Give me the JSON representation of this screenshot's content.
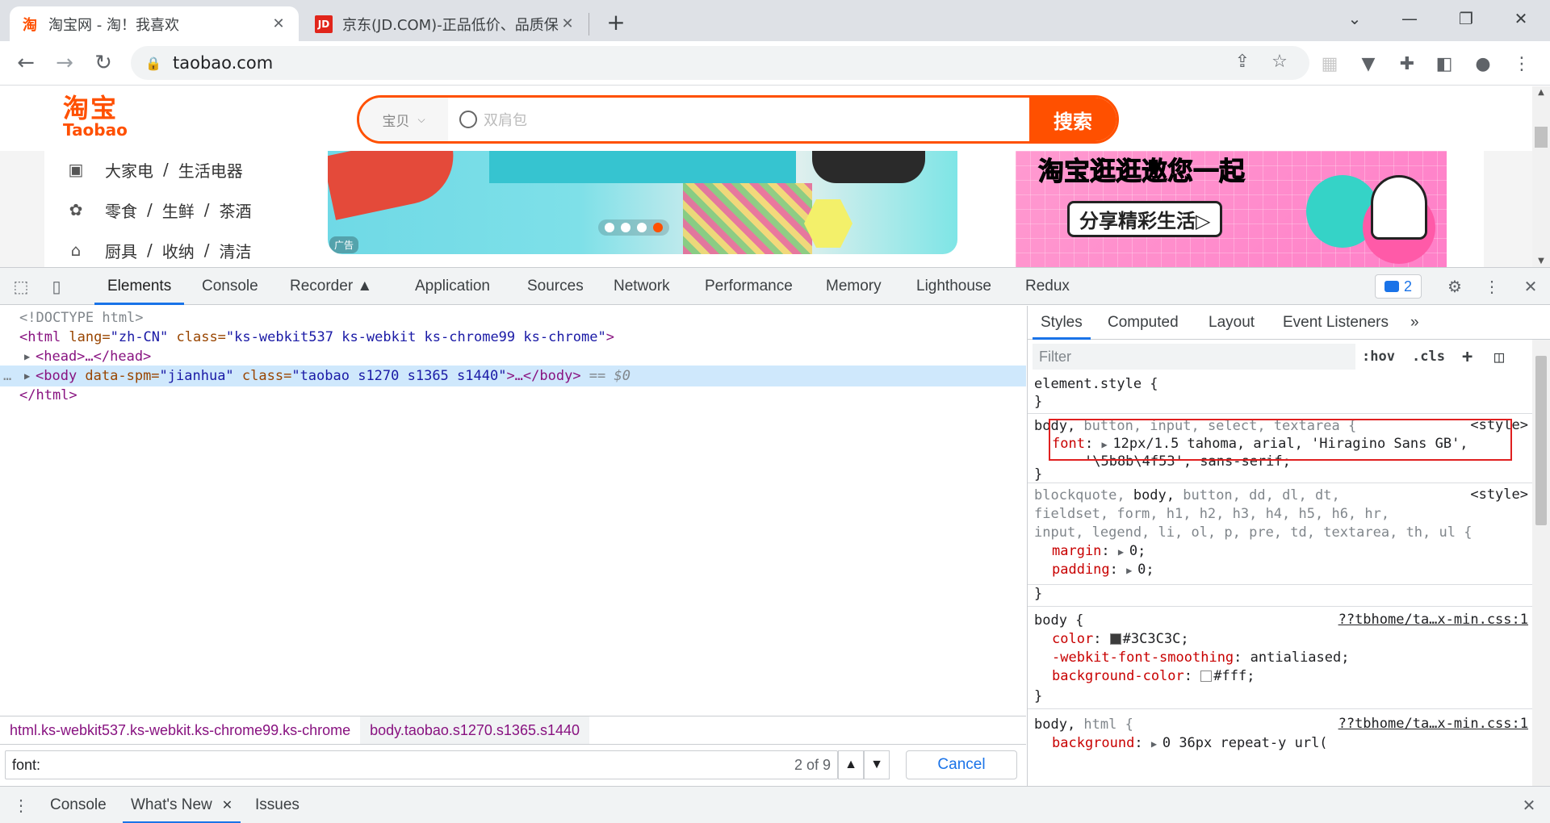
{
  "browser": {
    "tabs": [
      {
        "favicon": "淘",
        "title": "淘宝网 - 淘！我喜欢",
        "active": true
      },
      {
        "favicon": "JD",
        "title": "京东(JD.COM)-正品低价、品质保",
        "active": false
      }
    ],
    "new_tab_glyph": "+",
    "close_glyph": "✕",
    "url": "taobao.com"
  },
  "page": {
    "logo_cn": "淘宝",
    "logo_en": "Taobao",
    "search_category": "宝贝",
    "search_placeholder": "双肩包",
    "search_button": "搜索",
    "categories": [
      {
        "icon": "appliance-icon",
        "items": [
          "大家电",
          "生活电器"
        ]
      },
      {
        "icon": "cookie-icon",
        "items": [
          "零食",
          "生鲜",
          "茶酒"
        ]
      },
      {
        "icon": "pot-icon",
        "items": [
          "厨具",
          "收纳",
          "清洁"
        ]
      }
    ],
    "category_separator": "/",
    "ad_label": "广告",
    "promo_title": "淘宝逛逛邀您一起",
    "promo_subtitle": "分享精彩生活▷",
    "colors": {
      "brand": "#ff5000"
    }
  },
  "devtools": {
    "tabs": [
      "Elements",
      "Console",
      "Recorder ▲",
      "Application",
      "Sources",
      "Network",
      "Performance",
      "Memory",
      "Lighthouse",
      "Redux"
    ],
    "active_tab": "Elements",
    "issues_count": "2",
    "dom": {
      "doctype": "<!DOCTYPE html>",
      "html_open_tag": "<html",
      "html_lang_attr": " lang=",
      "html_lang_val": "\"zh-CN\"",
      "html_class_attr": " class=",
      "html_class_val": "\"ks-webkit537 ks-webkit ks-chrome99 ks-chrome\"",
      "html_open_end": ">",
      "head_collapsed": "<head>…</head>",
      "body_open_tag": "<body",
      "body_spm_attr": " data-spm=",
      "body_spm_val": "\"jianhua\"",
      "body_class_attr": " class=",
      "body_class_val": "\"taobao s1270 s1365 s1440\"",
      "body_rest": ">…</body>",
      "body_marker": " == $0",
      "html_close": "</html>",
      "ellipsis": "…"
    },
    "breadcrumbs": [
      "html.ks-webkit537.ks-webkit.ks-chrome99.ks-chrome",
      "body.taobao.s1270.s1365.s1440"
    ],
    "find": {
      "query": "font:",
      "count": "2 of 9",
      "cancel": "Cancel"
    },
    "styles": {
      "tabs": [
        "Styles",
        "Computed",
        "Layout",
        "Event Listeners",
        "»"
      ],
      "filter_placeholder": "Filter",
      "hov": ":hov",
      "cls": ".cls",
      "rules": {
        "element_style": "element.style {",
        "close": "}",
        "r1_selector_bold": "body, ",
        "r1_selector_rest": "button, input, select, textarea {",
        "r1_source": "<style>",
        "r1_prop": "font",
        "r1_value_1": "12px/1.5 tahoma, arial, 'Hiragino Sans GB',",
        "r1_value_2": "'\\5b8b\\4f53', sans-serif;",
        "r2_selector_1_pre": "blockquote, ",
        "r2_selector_1_bold": "body,",
        "r2_selector_1_post": " button, dd, dl, dt,",
        "r2_selector_2": "fieldset, form, h1, h2, h3, h4, h5, h6, hr,",
        "r2_selector_3": "input, legend, li, ol, p, pre, td, textarea, th, ul {",
        "r2_source": "<style>",
        "r2_prop_1": "margin",
        "r2_val_1": "0;",
        "r2_prop_2": "padding",
        "r2_val_2": "0;",
        "r3_selector": "body {",
        "r3_source": "??tbhome/ta…x-min.css:1",
        "r3_prop_1": "color",
        "r3_val_1": "#3C3C3C;",
        "r3_prop_2": "-webkit-font-smoothing",
        "r3_val_2": "antialiased;",
        "r3_prop_3": "background-color",
        "r3_val_3": "#fff;",
        "r4_selector_bold": "body, ",
        "r4_selector_rest": "html {",
        "r4_source": "??tbhome/ta…x-min.css:1",
        "r4_prop": "background",
        "r4_val": "0 36px repeat-y url("
      }
    },
    "drawer_tabs": [
      "Console",
      "What's New",
      "Issues"
    ],
    "drawer_active": "What's New"
  }
}
